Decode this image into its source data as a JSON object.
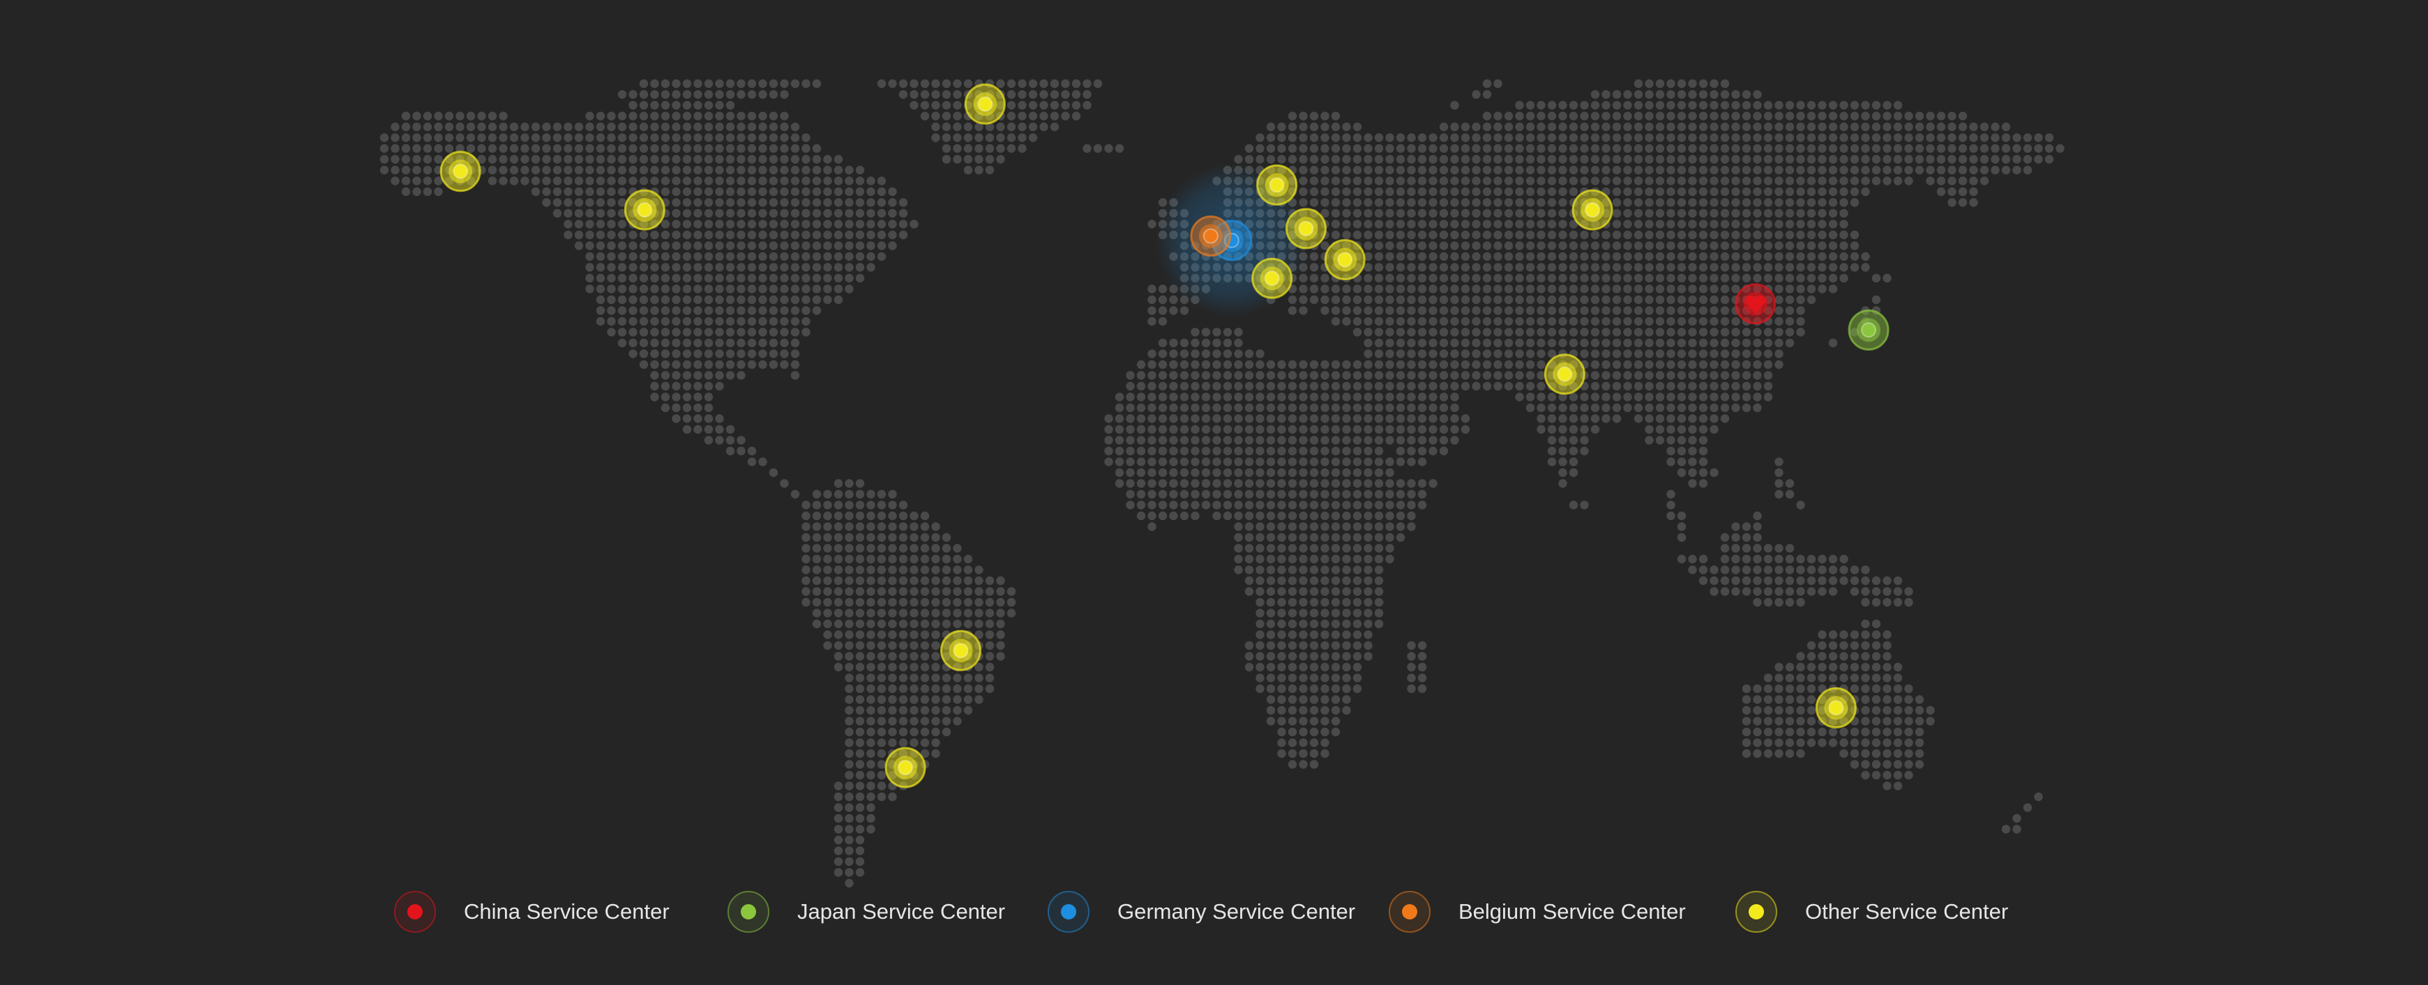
{
  "legend": [
    {
      "id": "china",
      "label": "China Service Center",
      "color": "#e3141b"
    },
    {
      "id": "japan",
      "label": "Japan Service Center",
      "color": "#8cc63f"
    },
    {
      "id": "germany",
      "label": "Germany Service Center",
      "color": "#1e8fe0"
    },
    {
      "id": "belgium",
      "label": "Belgium Service Center",
      "color": "#f07a1a"
    },
    {
      "id": "other",
      "label": "Other Service Center",
      "color": "#f2ea1d"
    }
  ],
  "colors": {
    "background": "#252525",
    "land_dot": "#4a4a4a",
    "legend_text": "#e6e6e6"
  },
  "service_centers": [
    {
      "name": "China Service Center",
      "type": "china",
      "lon": 116.4,
      "lat": 39.9,
      "icon": "heart-pin-icon"
    },
    {
      "name": "Japan Service Center",
      "type": "japan",
      "lon": 139.7,
      "lat": 35.7
    },
    {
      "name": "Germany Service Center",
      "type": "germany",
      "lon": 8.7,
      "lat": 50.1,
      "highlighted": true
    },
    {
      "name": "Belgium Service Center",
      "type": "belgium",
      "lon": 4.4,
      "lat": 50.8
    },
    {
      "name": "Other Service Center",
      "type": "other",
      "lon": -149.9,
      "lat": 61.2
    },
    {
      "name": "Other Service Center",
      "type": "other",
      "lon": -112,
      "lat": 55
    },
    {
      "name": "Other Service Center",
      "type": "other",
      "lon": -42,
      "lat": 72
    },
    {
      "name": "Other Service Center",
      "type": "other",
      "lon": 18,
      "lat": 59
    },
    {
      "name": "Other Service Center",
      "type": "other",
      "lon": 24,
      "lat": 52
    },
    {
      "name": "Other Service Center",
      "type": "other",
      "lon": 32,
      "lat": 47
    },
    {
      "name": "Other Service Center",
      "type": "other",
      "lon": 17,
      "lat": 44
    },
    {
      "name": "Other Service Center",
      "type": "other",
      "lon": 82.9,
      "lat": 55
    },
    {
      "name": "Other Service Center",
      "type": "other",
      "lon": 77.2,
      "lat": 28.6
    },
    {
      "name": "Other Service Center",
      "type": "other",
      "lon": -47,
      "lat": -15.8
    },
    {
      "name": "Other Service Center",
      "type": "other",
      "lon": -58.4,
      "lat": -34.6
    },
    {
      "name": "Other Service Center",
      "type": "other",
      "lon": 133,
      "lat": -25
    }
  ]
}
